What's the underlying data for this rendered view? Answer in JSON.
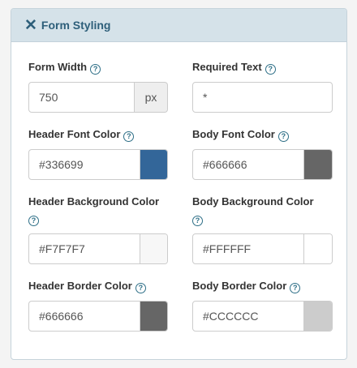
{
  "panel": {
    "close_glyph": "✕",
    "title": "Form Styling",
    "help_glyph": "?"
  },
  "fields": {
    "form_width": {
      "label": "Form Width",
      "value": "750",
      "unit": "px"
    },
    "required_text": {
      "label": "Required Text",
      "value": "*"
    },
    "header_font_color": {
      "label": "Header Font Color",
      "value": "#336699",
      "color": "#336699"
    },
    "body_font_color": {
      "label": "Body Font Color",
      "value": "#666666",
      "color": "#666666"
    },
    "header_bg_color": {
      "label": "Header Background Color",
      "value": "#F7F7F7",
      "color": "#F7F7F7"
    },
    "body_bg_color": {
      "label": "Body Background Color",
      "value": "#FFFFFF",
      "color": "#FFFFFF"
    },
    "header_border_color": {
      "label": "Header Border Color",
      "value": "#666666",
      "color": "#666666"
    },
    "body_border_color": {
      "label": "Body Border Color",
      "value": "#CCCCCC",
      "color": "#CCCCCC"
    }
  },
  "theme": {
    "accent": "#2e5f7a",
    "header_bg": "#d5e2e9"
  }
}
